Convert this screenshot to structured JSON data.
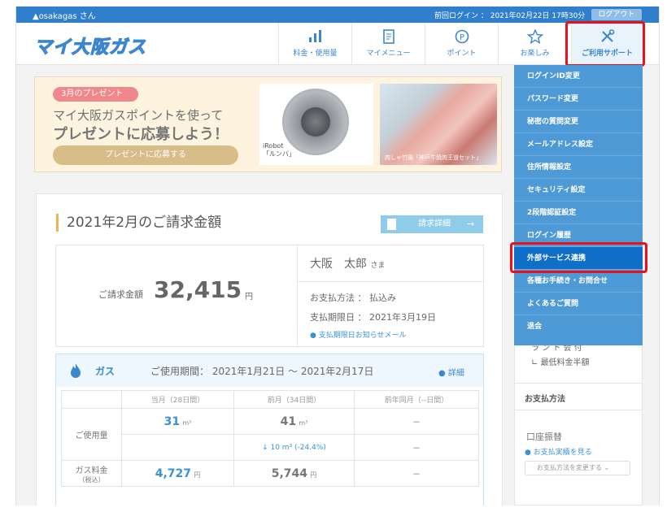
{
  "topbar": {
    "user": "▲osakagas さん",
    "last_login": "前回ログイン ： 2021年02月22日 17時30分",
    "logout": "ログアウト"
  },
  "header": {
    "logo": "マイ大阪ガス",
    "nav": [
      {
        "label": "料金・使用量",
        "icon": "bar-chart-icon"
      },
      {
        "label": "マイメニュー",
        "icon": "document-icon"
      },
      {
        "label": "ポイント",
        "icon": "point-icon"
      },
      {
        "label": "お楽しみ",
        "icon": "star-icon"
      },
      {
        "label": "ご利用サポート",
        "icon": "tools-icon"
      }
    ]
  },
  "banner": {
    "badge": "3月のプレゼント",
    "line1": "マイ大阪ガスポイントを使って",
    "line2": "プレゼントに応募しよう！",
    "button": "プレゼントに応募する",
    "robot_caption1": "iRobot",
    "robot_caption2": "「ルンバ」",
    "meat_caption": "肉しゃ竹園「神戸牛焼肉王道セット」"
  },
  "bill": {
    "title": "2021年2月のご請求金額",
    "detail_button": "請求詳細",
    "amount_label": "ご請求金額",
    "amount": "32,415",
    "yen": "円",
    "name": "大阪　太郎",
    "sama": "さま",
    "pay_method": "お支払方法 ： 払込み",
    "due_date": "支払期限日 ： 2021年3月19日",
    "reminder": "支払期限日お知らせメール"
  },
  "gas": {
    "label": "ガス",
    "period": "ご使用期間： 2021年1月21日 ～ 2021年2月17日",
    "details": "詳細",
    "headers": [
      "",
      "当月（28日間）",
      "前月（34日間）",
      "前年同月（--日間）"
    ],
    "usage_label": "ご使用量",
    "usage_current": "31",
    "usage_prev": "41",
    "usage_prev_year": "－",
    "usage_unit": "m³",
    "usage_diff": "10 m³ (-24.4%)",
    "usage_diff_prev_year": "－",
    "fee_label": "ガス料金",
    "fee_sub": "（税込）",
    "fee_current": "4,727",
    "fee_prev": "5,744",
    "fee_prev_year": "－",
    "fee_unit": "円"
  },
  "dropdown": {
    "items": [
      "ログインID変更",
      "パスワード変更",
      "秘密の質問変更",
      "メールアドレス設定",
      "住所情報設定",
      "セキュリティ設定",
      "2段階認証設定",
      "ログイン履歴",
      "外部サービス連携",
      "各種お手続き・お問合せ",
      "よくあるご質問",
      "退会"
    ],
    "selected_index": 8
  },
  "side": {
    "line1": "ラ ン ト 会 付",
    "line2": "最低料金半額",
    "section": "お支払方法",
    "method": "口座振替",
    "history_link": "お支払実績を見る",
    "change_select": "お支払方法を変更する"
  },
  "colors": {
    "brand": "#2f7fcc",
    "highlight": "#e8101a",
    "dropdown": "#4e9ad7"
  }
}
